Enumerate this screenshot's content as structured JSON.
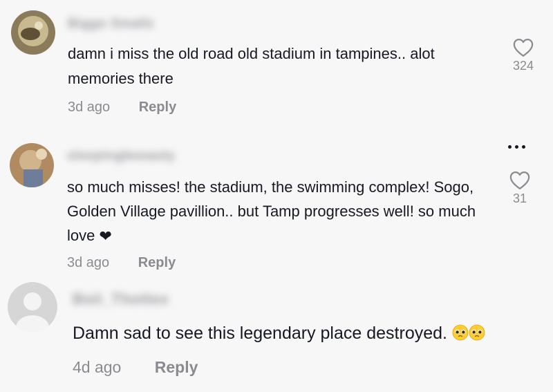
{
  "comments": [
    {
      "username": "Biggo Smallz",
      "text": "damn i miss the old road old stadium in tampines.. alot memories there",
      "time": "3d ago",
      "reply_label": "Reply",
      "likes": "324"
    },
    {
      "username": "sleepingbeeauty",
      "text": "so much misses! the stadium, the swimming complex! Sogo, Golden Village pavillion.. but Tamp progresses well! so much love",
      "trailing_emoji": "❤",
      "time": "3d ago",
      "reply_label": "Reply",
      "likes": "31"
    },
    {
      "username": "Boii_Thottex",
      "text": "Damn sad to see this legendary place destroyed.",
      "trailing_emoji": "🥺🥺",
      "time": "4d ago",
      "reply_label": "Reply"
    }
  ],
  "icons": {
    "like": "heart-outline-icon",
    "more": "more-options-icon",
    "default_avatar": "default-avatar-icon"
  }
}
